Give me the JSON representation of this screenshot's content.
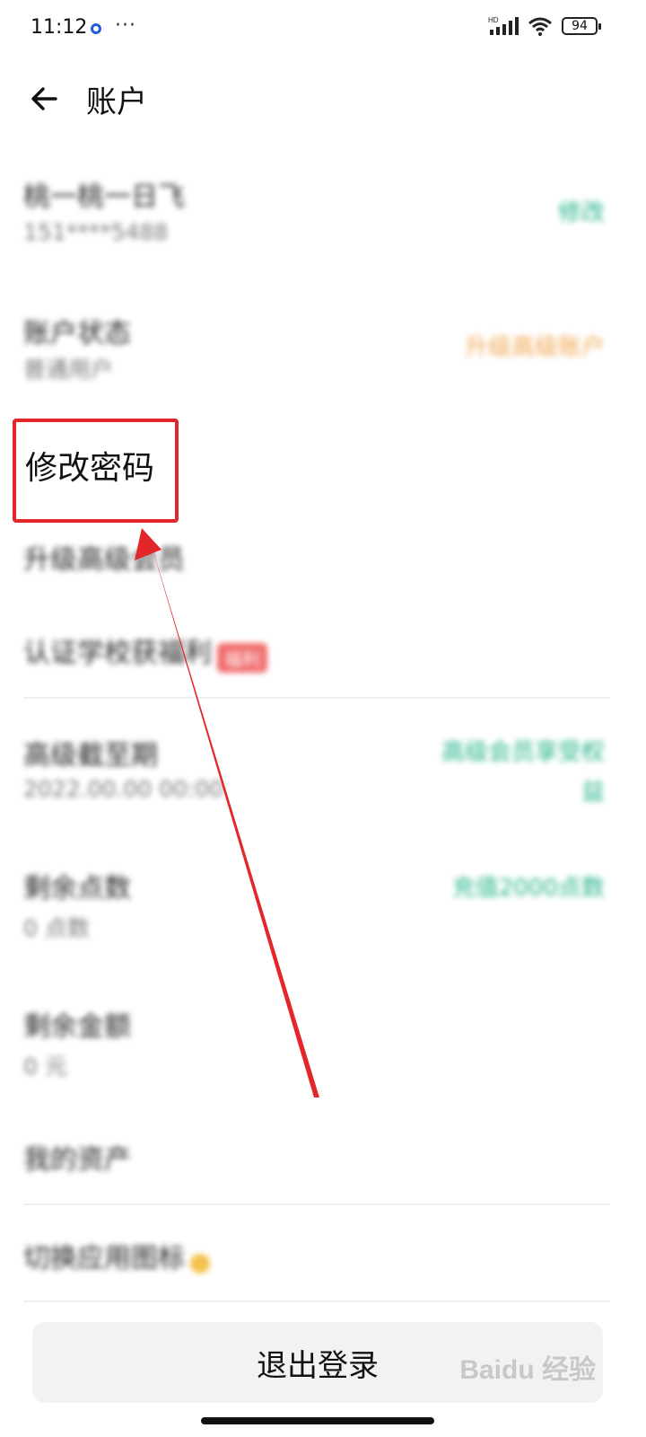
{
  "status_bar": {
    "time": "11:12",
    "more": "···",
    "network": "HD",
    "battery": "94"
  },
  "header": {
    "title": "账户"
  },
  "rows": [
    {
      "title": "桃一桃一日飞",
      "subtitle": "151****5488",
      "right": "修改"
    },
    {
      "title": "账户状态",
      "subtitle": "普通用户",
      "right": "升级高级账户"
    },
    {
      "title": "修改密码"
    },
    {
      "title": "升级高级会员"
    },
    {
      "title": "认证学校获福利",
      "badge": "福利"
    },
    {
      "title": "高级截至期",
      "subtitle": "2022.00.00 00:00",
      "right": "高级会员享受权益"
    },
    {
      "title": "剩余点数",
      "subtitle": "0 点数",
      "right": "充值2000点数"
    },
    {
      "title": "剩余金额",
      "subtitle": "0 元"
    },
    {
      "title": "我的资产"
    },
    {
      "title": "切换应用图标"
    }
  ],
  "logout": {
    "label": "退出登录"
  },
  "watermark": "Baidu 经验",
  "colors": {
    "accent_green": "#25b38a",
    "accent_orange": "#f0a650",
    "highlight_red": "#e3262a"
  }
}
